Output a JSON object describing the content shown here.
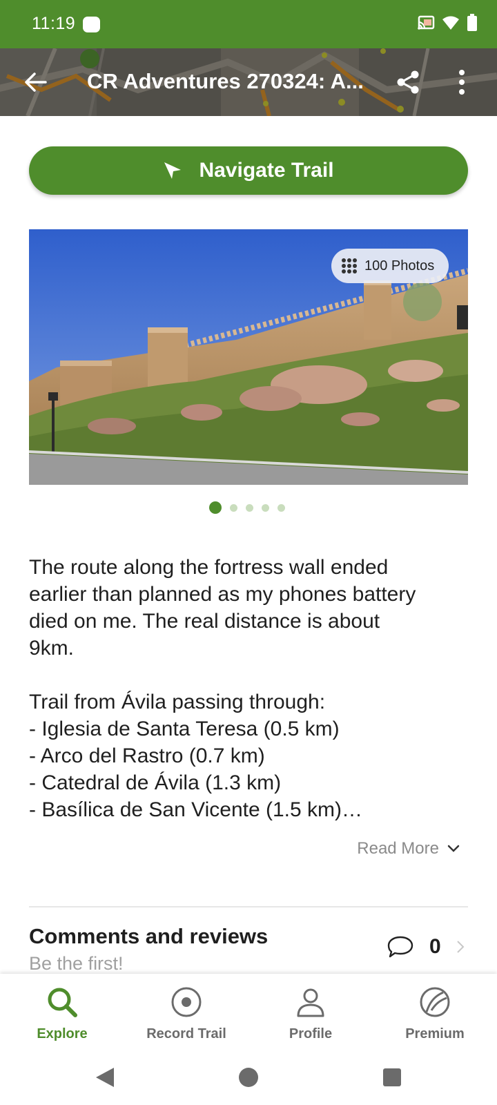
{
  "status_bar": {
    "time": "11:19"
  },
  "app_bar": {
    "title": "CR Adventures 270324: A..."
  },
  "navigate_button": {
    "label": "Navigate Trail"
  },
  "photo": {
    "badge_label": "100 Photos",
    "pager_count": 5,
    "pager_active": 1
  },
  "description": {
    "paragraph1": [
      "The route along the fortress wall ended",
      "earlier than planned as my phones battery",
      "died on me. The real distance is about",
      "9km."
    ],
    "paragraph2": [
      "Trail from Ávila passing through:",
      "- Iglesia de Santa Teresa (0.5 km)",
      "- Arco del Rastro (0.7 km)",
      "- Catedral de Ávila (1.3 km)",
      "- Basílica de San Vicente (1.5 km)…"
    ],
    "read_more": "Read More"
  },
  "comments": {
    "title": "Comments and reviews",
    "subtitle": "Be the first!",
    "count": "0"
  },
  "bottom_nav": {
    "items": [
      {
        "label": "Explore",
        "icon": "search-icon",
        "active": true
      },
      {
        "label": "Record Trail",
        "icon": "record-icon",
        "active": false
      },
      {
        "label": "Profile",
        "icon": "profile-icon",
        "active": false
      },
      {
        "label": "Premium",
        "icon": "premium-icon",
        "active": false
      }
    ]
  },
  "colors": {
    "brand_green": "#4f8d2c",
    "pager_inactive": "#c9ddbd"
  }
}
